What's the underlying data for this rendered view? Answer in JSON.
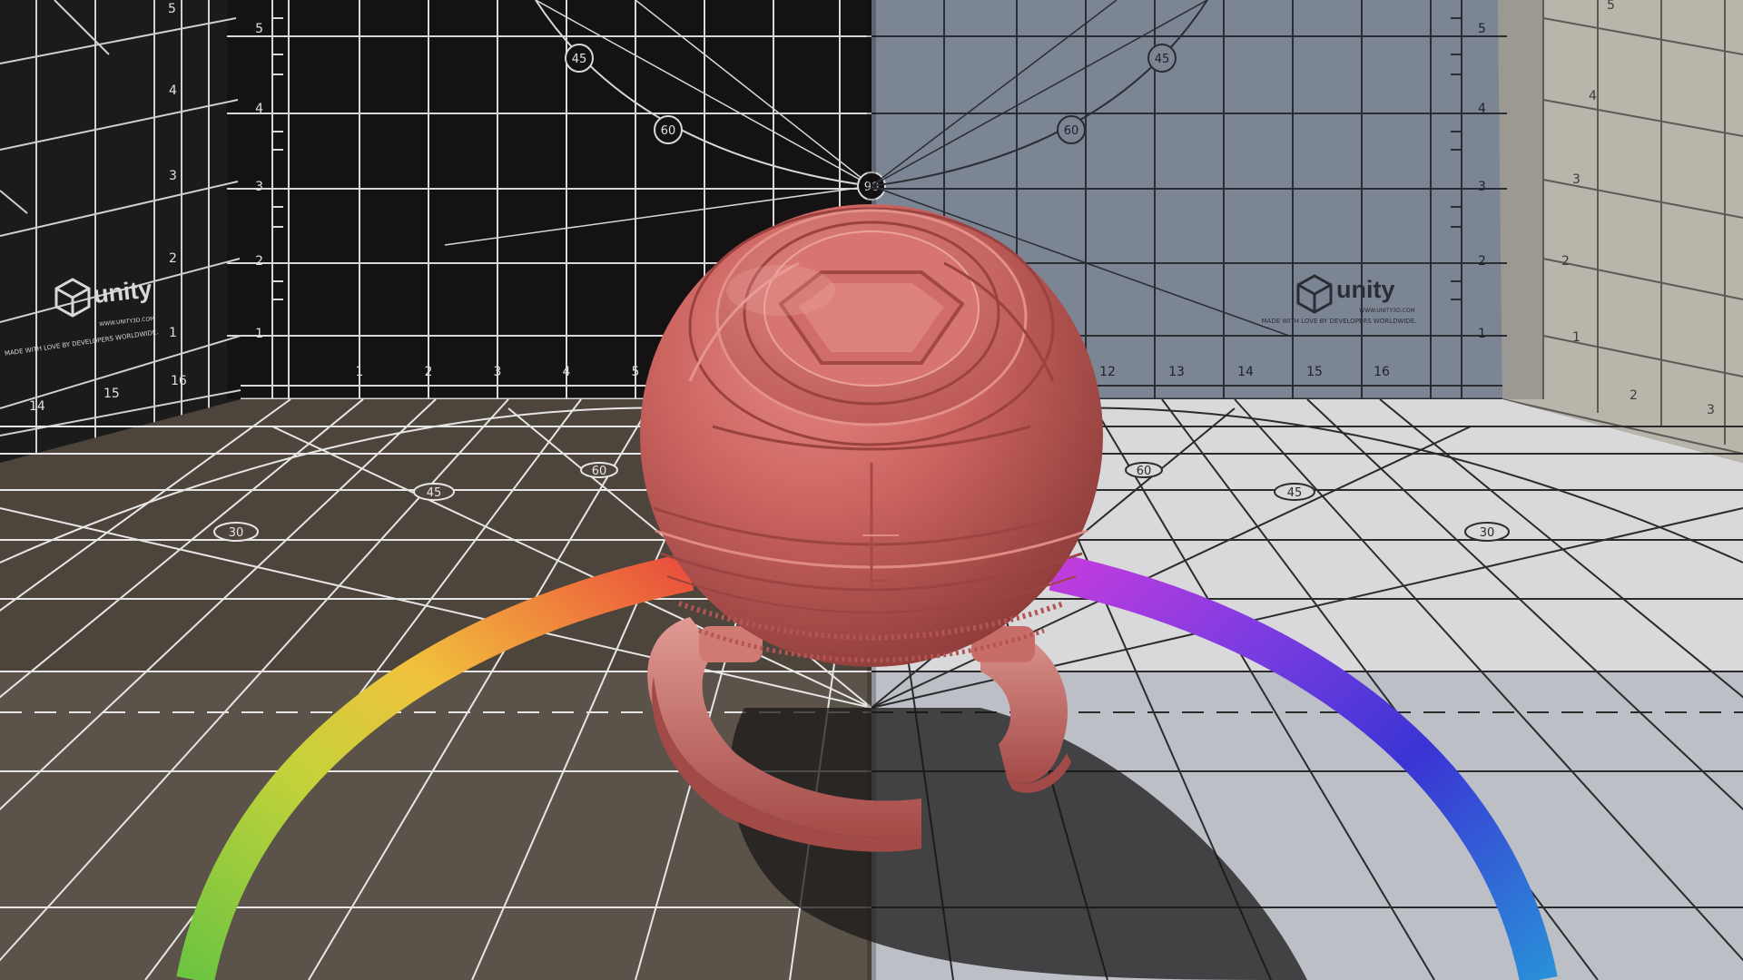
{
  "scene": {
    "left_wall": {
      "logo_text": "unity",
      "logo_url": "WWW.UNITY3D.COM",
      "logo_tagline": "MADE WITH LOVE BY DEVELOPERS WORLDWIDE.",
      "v_ticks": [
        "1",
        "2",
        "3",
        "4",
        "5"
      ],
      "h_ticks": [
        "14",
        "15",
        "16"
      ]
    },
    "back_wall_dark": {
      "v_ticks": [
        "1",
        "2",
        "3",
        "4",
        "5"
      ],
      "h_ticks": [
        "1",
        "2",
        "3",
        "4",
        "5"
      ],
      "angle_labels": [
        "45",
        "60",
        "90"
      ]
    },
    "back_wall_light": {
      "logo_text": "unity",
      "logo_url": "WWW.UNITY3D.COM",
      "logo_tagline": "MADE WITH LOVE BY DEVELOPERS WORLDWIDE.",
      "v_ticks": [
        "1",
        "2",
        "3",
        "4",
        "5"
      ],
      "h_ticks": [
        "12",
        "13",
        "14",
        "15",
        "16"
      ],
      "angle_labels": [
        "60",
        "45"
      ]
    },
    "right_wall": {
      "v_ticks": [
        "1",
        "2",
        "3",
        "4",
        "5"
      ],
      "h_ticks": [
        "2",
        "3"
      ]
    },
    "floor_dark": {
      "angle_labels": [
        "30",
        "45",
        "60"
      ]
    },
    "floor_light": {
      "angle_labels": [
        "60",
        "45",
        "30"
      ]
    },
    "colors": {
      "dark_wall": "#141212",
      "light_wall": "#7c8593",
      "right_wall": "#b9b5ab",
      "dark_floor": "#4d443c",
      "light_floor": "#d9d9dc",
      "grid_light": "#cfcfcf",
      "grid_dark": "#2a2a2a",
      "sphere": "#c9615e",
      "sphere_shadow": "#7a3230",
      "sphere_highlight": "#e58b86"
    }
  }
}
